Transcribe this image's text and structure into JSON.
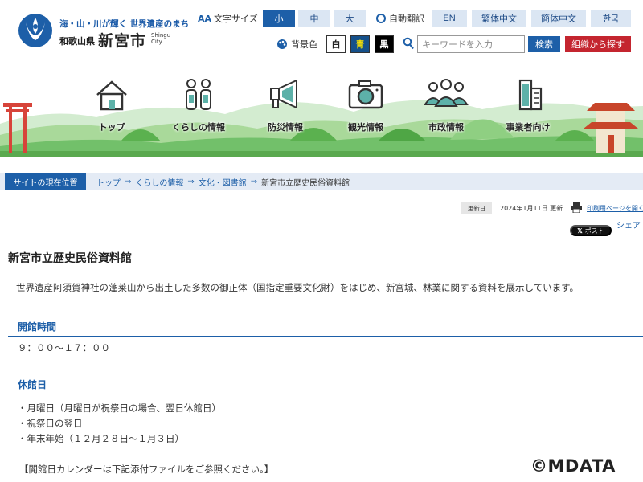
{
  "header": {
    "tagline": "海・山・川が輝く 世界遺産のまち",
    "prefecture": "和歌山県",
    "city_name": "新宮市",
    "city_name_en_line1": "Shingu",
    "city_name_en_line2": "City"
  },
  "font_size": {
    "label": "文字サイズ",
    "small": "小",
    "medium": "中",
    "large": "大"
  },
  "translate": {
    "label": "自動翻訳",
    "en": "EN",
    "zh_tw": "繁体中文",
    "zh_cn": "簡体中文",
    "ko": "한국"
  },
  "background": {
    "label": "背景色",
    "white": "白",
    "blue": "青",
    "black": "黒"
  },
  "search": {
    "placeholder": "キーワードを入力",
    "button": "検索",
    "org_button": "組織から探す"
  },
  "nav": {
    "top": "トップ",
    "life": "くらしの情報",
    "disaster": "防災情報",
    "tourism": "観光情報",
    "city_admin": "市政情報",
    "business": "事業者向け"
  },
  "breadcrumb": {
    "label": "サイトの現在位置",
    "items": [
      "トップ",
      "くらしの情報",
      "文化・図書館",
      "新宮市立歴史民俗資料館"
    ],
    "separator": "⇒"
  },
  "meta": {
    "updated_tag": "更新日",
    "updated_date": "2024年1月11日 更新",
    "print_link": "印刷用ページを開く",
    "share_label": "シェア",
    "x_post": "ポスト"
  },
  "content": {
    "title": "新宮市立歴史民俗資料館",
    "intro": "世界遺産阿須賀神社の蓬莱山から出土した多数の御正体（国指定重要文化財）をはじめ、新宮城、林業に関する資料を展示しています。",
    "hours_heading": "開館時間",
    "hours_text": "９：００～１７：００",
    "closed_heading": "休館日",
    "closed_items": [
      "・月曜日（月曜日が祝祭日の場合、翌日休館日）",
      "・祝祭日の翌日",
      "・年末年始（１２月２８日～１月３日）"
    ],
    "calendar_note": "【開館日カレンダーは下記添付ファイルをご参照ください。】"
  },
  "watermark": "©MDATA",
  "colors": {
    "brand_blue": "#1d5fa8",
    "accent_red": "#c4252f",
    "breadcrumb_bg": "#e4ebf5"
  }
}
